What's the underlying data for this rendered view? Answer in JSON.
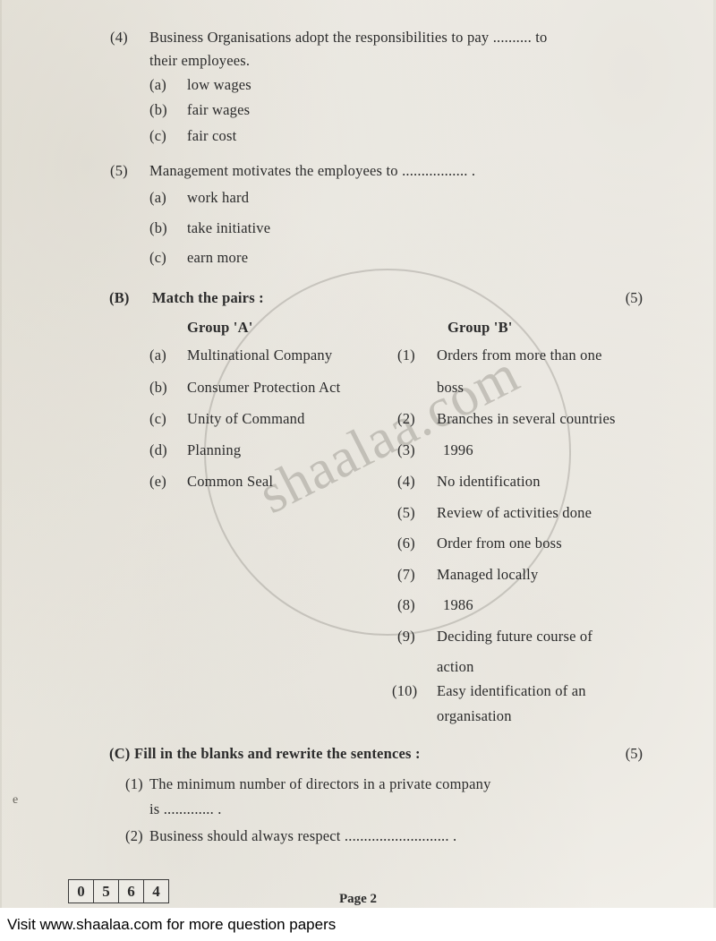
{
  "document": {
    "questions": [
      {
        "num": "(4)",
        "text": "Business Organisations adopt the responsibilities to pay .......... to"
      },
      {
        "num": "",
        "text": "their employees."
      }
    ],
    "q4": {
      "number": "(4)",
      "line1": "Business Organisations adopt the responsibilities to pay .......... to",
      "line2": "their employees.",
      "options": [
        {
          "label": "(a)",
          "text": "low wages"
        },
        {
          "label": "(b)",
          "text": "fair wages"
        },
        {
          "label": "(c)",
          "text": "fair cost"
        }
      ]
    },
    "q5": {
      "number": "(5)",
      "line1": "Management motivates the employees to  ................. .",
      "options": [
        {
          "label": "(a)",
          "text": "work hard"
        },
        {
          "label": "(b)",
          "text": "take initiative"
        },
        {
          "label": "(c)",
          "text": "earn more"
        }
      ]
    },
    "sectionB": {
      "label": "(B)",
      "title": "Match the pairs :",
      "marks": "(5)",
      "groupA_heading": "Group 'A'",
      "groupB_heading": "Group 'B'",
      "groupA": [
        {
          "label": "(a)",
          "text": "Multinational Company"
        },
        {
          "label": "(b)",
          "text": "Consumer Protection Act"
        },
        {
          "label": "(c)",
          "text": "Unity of Command"
        },
        {
          "label": "(d)",
          "text": "Planning"
        },
        {
          "label": "(e)",
          "text": "Common Seal"
        }
      ],
      "groupB": [
        {
          "label": "(1)",
          "text": "Orders from more than one",
          "text2": "boss"
        },
        {
          "label": "(2)",
          "text": "Branches in several countries"
        },
        {
          "label": "(3)",
          "text": "1996"
        },
        {
          "label": "(4)",
          "text": "No identification"
        },
        {
          "label": "(5)",
          "text": "Review of activities done"
        },
        {
          "label": "(6)",
          "text": "Order from one boss"
        },
        {
          "label": "(7)",
          "text": "Managed locally"
        },
        {
          "label": "(8)",
          "text": "1986"
        },
        {
          "label": "(9)",
          "text": "Deciding future course of",
          "text2": "action"
        },
        {
          "label": "(10)",
          "text": "Easy identification of an",
          "text2": "organisation"
        }
      ]
    },
    "sectionC": {
      "label": "(C)",
      "title": "Fill in the blanks and rewrite the sentences  :",
      "marks": "(5)",
      "items": [
        {
          "label": "(1)",
          "text": "The minimum number of directors in a private company",
          "text2": "is ............. ."
        },
        {
          "label": "(2)",
          "text": "Business should always respect ........................... ."
        }
      ]
    },
    "footer": {
      "code_digits": [
        "0",
        "5",
        "6",
        "4"
      ],
      "page_label": "Page 2",
      "stray_mark": "e"
    }
  },
  "watermark": {
    "text": "shaalaa.com"
  },
  "promo": {
    "text": "Visit www.shaalaa.com for more question papers"
  }
}
